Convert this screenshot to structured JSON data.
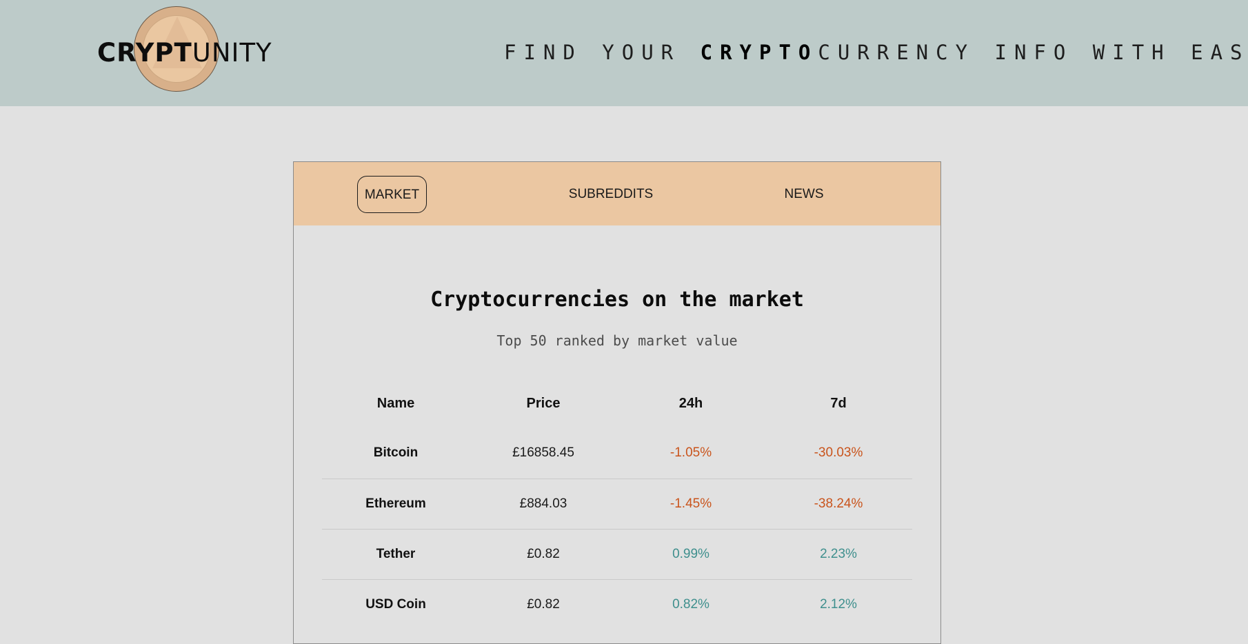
{
  "header": {
    "logo": {
      "bold": "CRYPT",
      "light": "UNITY"
    },
    "tagline": {
      "before": "FIND YOUR ",
      "strong": "CRYPTO",
      "after": "CURRENCY INFO WITH EASE"
    }
  },
  "nav": {
    "items": [
      {
        "label": "MARKET",
        "active": true
      },
      {
        "label": "SUBREDDITS",
        "active": false
      },
      {
        "label": "NEWS",
        "active": false
      }
    ]
  },
  "main": {
    "title": "Cryptocurrencies on the market",
    "subtitle": "Top 50 ranked by market value",
    "table": {
      "columns": [
        "Name",
        "Price",
        "24h",
        "7d"
      ],
      "rows": [
        {
          "name": "Bitcoin",
          "price": "£16858.45",
          "change_24h": "-1.05%",
          "change_7d": "-30.03%"
        },
        {
          "name": "Ethereum",
          "price": "£884.03",
          "change_24h": "-1.45%",
          "change_7d": "-38.24%"
        },
        {
          "name": "Tether",
          "price": "£0.82",
          "change_24h": "0.99%",
          "change_7d": "2.23%"
        },
        {
          "name": "USD Coin",
          "price": "£0.82",
          "change_24h": "0.82%",
          "change_7d": "2.12%"
        }
      ]
    }
  },
  "colors": {
    "header_bg": "#bdcbc9",
    "page_bg": "#e1e1e1",
    "nav_bg": "#ebc7a2",
    "negative": "#c9541c",
    "positive": "#3e8f8d"
  }
}
